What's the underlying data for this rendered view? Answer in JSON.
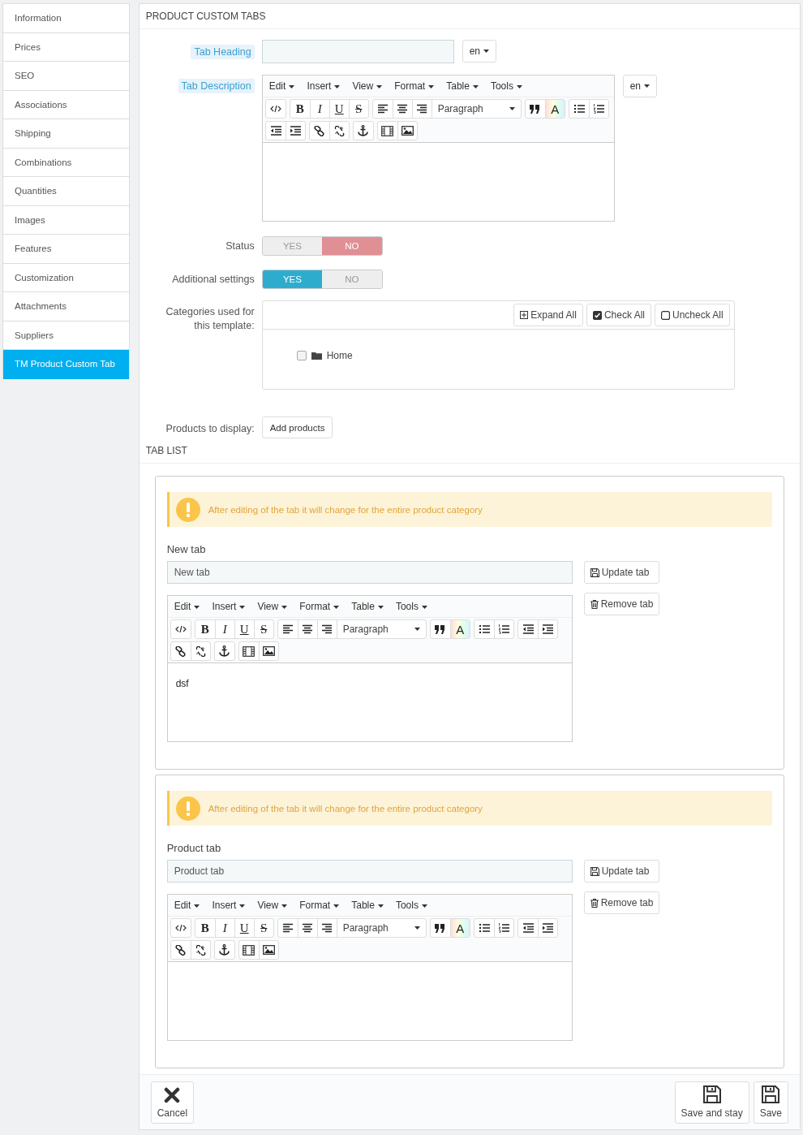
{
  "sidebar": {
    "items": [
      {
        "label": "Information",
        "selected": false
      },
      {
        "label": "Prices",
        "selected": false
      },
      {
        "label": "SEO",
        "selected": false
      },
      {
        "label": "Associations",
        "selected": false
      },
      {
        "label": "Shipping",
        "selected": false
      },
      {
        "label": "Combinations",
        "selected": false
      },
      {
        "label": "Quantities",
        "selected": false
      },
      {
        "label": "Images",
        "selected": false
      },
      {
        "label": "Features",
        "selected": false
      },
      {
        "label": "Customization",
        "selected": false
      },
      {
        "label": "Attachments",
        "selected": false
      },
      {
        "label": "Suppliers",
        "selected": false
      },
      {
        "label": "TM Product Custom Tab",
        "selected": true
      }
    ]
  },
  "panel": {
    "title": "PRODUCT CUSTOM TABS"
  },
  "form": {
    "tab_heading": {
      "label": "Tab Heading",
      "language": "en"
    },
    "tab_description": {
      "label": "Tab Description",
      "language": "en",
      "editor": {
        "menu": [
          "Edit",
          "Insert",
          "View",
          "Format",
          "Table",
          "Tools"
        ],
        "format_glyphs": [
          "B",
          "I",
          "U",
          "S"
        ],
        "block_format": "Paragraph",
        "color_glyph": "A"
      }
    },
    "switches": [
      {
        "label": "Status",
        "options": [
          {
            "label": "YES",
            "selected": false
          },
          {
            "label": "NO",
            "selected": true
          }
        ]
      },
      {
        "label": "Additional settings",
        "options": [
          {
            "label": "YES",
            "selected": true
          },
          {
            "label": "NO",
            "selected": false
          }
        ]
      }
    ],
    "categories": {
      "label": "Categories used for this template:",
      "buttons": [
        {
          "label": "Expand All",
          "kind": "expand"
        },
        {
          "label": "Check All",
          "kind": "check"
        },
        {
          "label": "Uncheck All",
          "kind": "uncheck"
        }
      ],
      "tree": [
        {
          "label": "Home",
          "checked": false
        }
      ]
    },
    "products": {
      "label": "Products to display:",
      "button": "Add products"
    }
  },
  "tab_list": {
    "title": "TAB LIST",
    "tabs": [
      {
        "alert": "After editing of the tab it will change for the entire product category",
        "title": "New tab",
        "value": "New tab",
        "buttons": [
          "Update tab",
          "Remove tab"
        ],
        "editor": {
          "menu": [
            "Edit",
            "Insert",
            "View",
            "Format",
            "Table",
            "Tools"
          ],
          "format_glyphs": [
            "B",
            "I",
            "U",
            "S"
          ],
          "block_format": "Paragraph",
          "color_glyph": "A",
          "content": "dsf"
        }
      },
      {
        "alert": "After editing of the tab it will change for the entire product category",
        "title": "Product tab",
        "value": "Product tab",
        "buttons": [
          "Update tab",
          "Remove tab"
        ],
        "editor": {
          "menu": [
            "Edit",
            "Insert",
            "View",
            "Format",
            "Table",
            "Tools"
          ],
          "format_glyphs": [
            "B",
            "I",
            "U",
            "S"
          ],
          "block_format": "Paragraph",
          "color_glyph": "A"
        }
      }
    ]
  },
  "footer": {
    "buttons": [
      {
        "label": "Cancel",
        "kind": "cancel"
      },
      {
        "label": "Save and stay",
        "kind": "save"
      },
      {
        "label": "Save",
        "kind": "save"
      }
    ]
  }
}
